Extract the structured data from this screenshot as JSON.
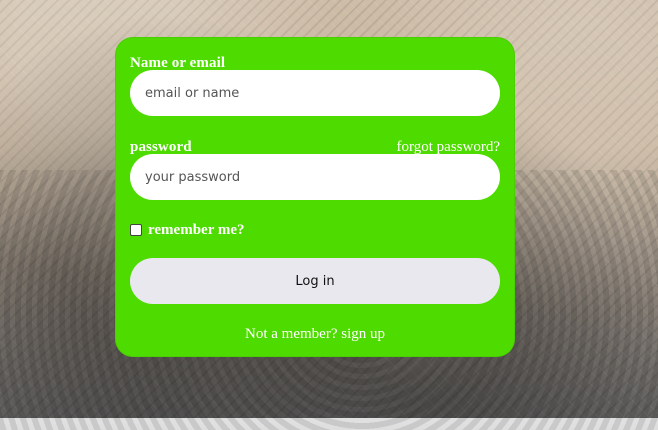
{
  "colors": {
    "card_bg": "#4edb00",
    "input_bg": "#ffffff",
    "button_bg": "#e9e8ee",
    "text_on_card": "#ffffff"
  },
  "form": {
    "email_label": "Name or email",
    "email_placeholder": "email or name",
    "password_label": "password",
    "forgot_link": "forgot password?",
    "password_placeholder": "your password",
    "remember_label": "remember me?",
    "login_button": "Log in",
    "signup_link": "Not a member? sign up"
  }
}
